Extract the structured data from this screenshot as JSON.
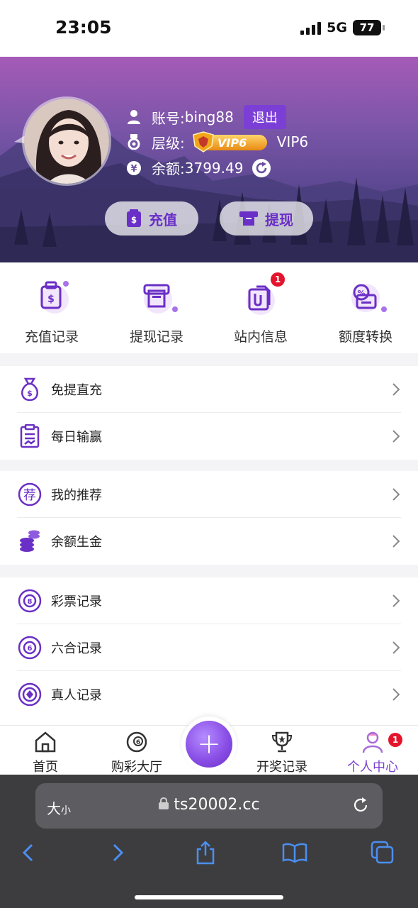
{
  "status": {
    "time": "23:05",
    "network": "5G",
    "battery": "77"
  },
  "profile": {
    "account_label": "账号:",
    "account_value": "bing88",
    "logout_label": "退出",
    "level_label": "层级:",
    "vip_badge": "VIP6",
    "vip_text": "VIP6",
    "balance_label": "余额:",
    "balance_value": "3799.49",
    "recharge_label": "充值",
    "withdraw_label": "提现"
  },
  "quick": [
    {
      "label": "充值记录",
      "icon": "recharge-record-icon"
    },
    {
      "label": "提现记录",
      "icon": "withdraw-record-icon"
    },
    {
      "label": "站内信息",
      "icon": "messages-icon",
      "badge": "1"
    },
    {
      "label": "额度转换",
      "icon": "transfer-icon"
    }
  ],
  "menu": {
    "group1": [
      {
        "label": "免提直充",
        "icon": "money-bag-icon"
      },
      {
        "label": "每日输赢",
        "icon": "report-icon"
      }
    ],
    "group2": [
      {
        "label": "我的推荐",
        "icon": "recommend-icon"
      },
      {
        "label": "余额生金",
        "icon": "coins-icon"
      }
    ],
    "group3": [
      {
        "label": "彩票记录",
        "icon": "lottery-icon"
      },
      {
        "label": "六合记录",
        "icon": "six-icon"
      },
      {
        "label": "真人记录",
        "icon": "live-casino-icon"
      }
    ]
  },
  "tabbar": {
    "home": "首页",
    "lobby": "购彩大厅",
    "results": "开奖记录",
    "me": "个人中心",
    "me_badge": "1"
  },
  "browser": {
    "size_big": "大",
    "size_small": "小",
    "url": "ts20002.cc"
  },
  "colors": {
    "accent": "#7a3fd0",
    "badge": "#e4142b"
  }
}
